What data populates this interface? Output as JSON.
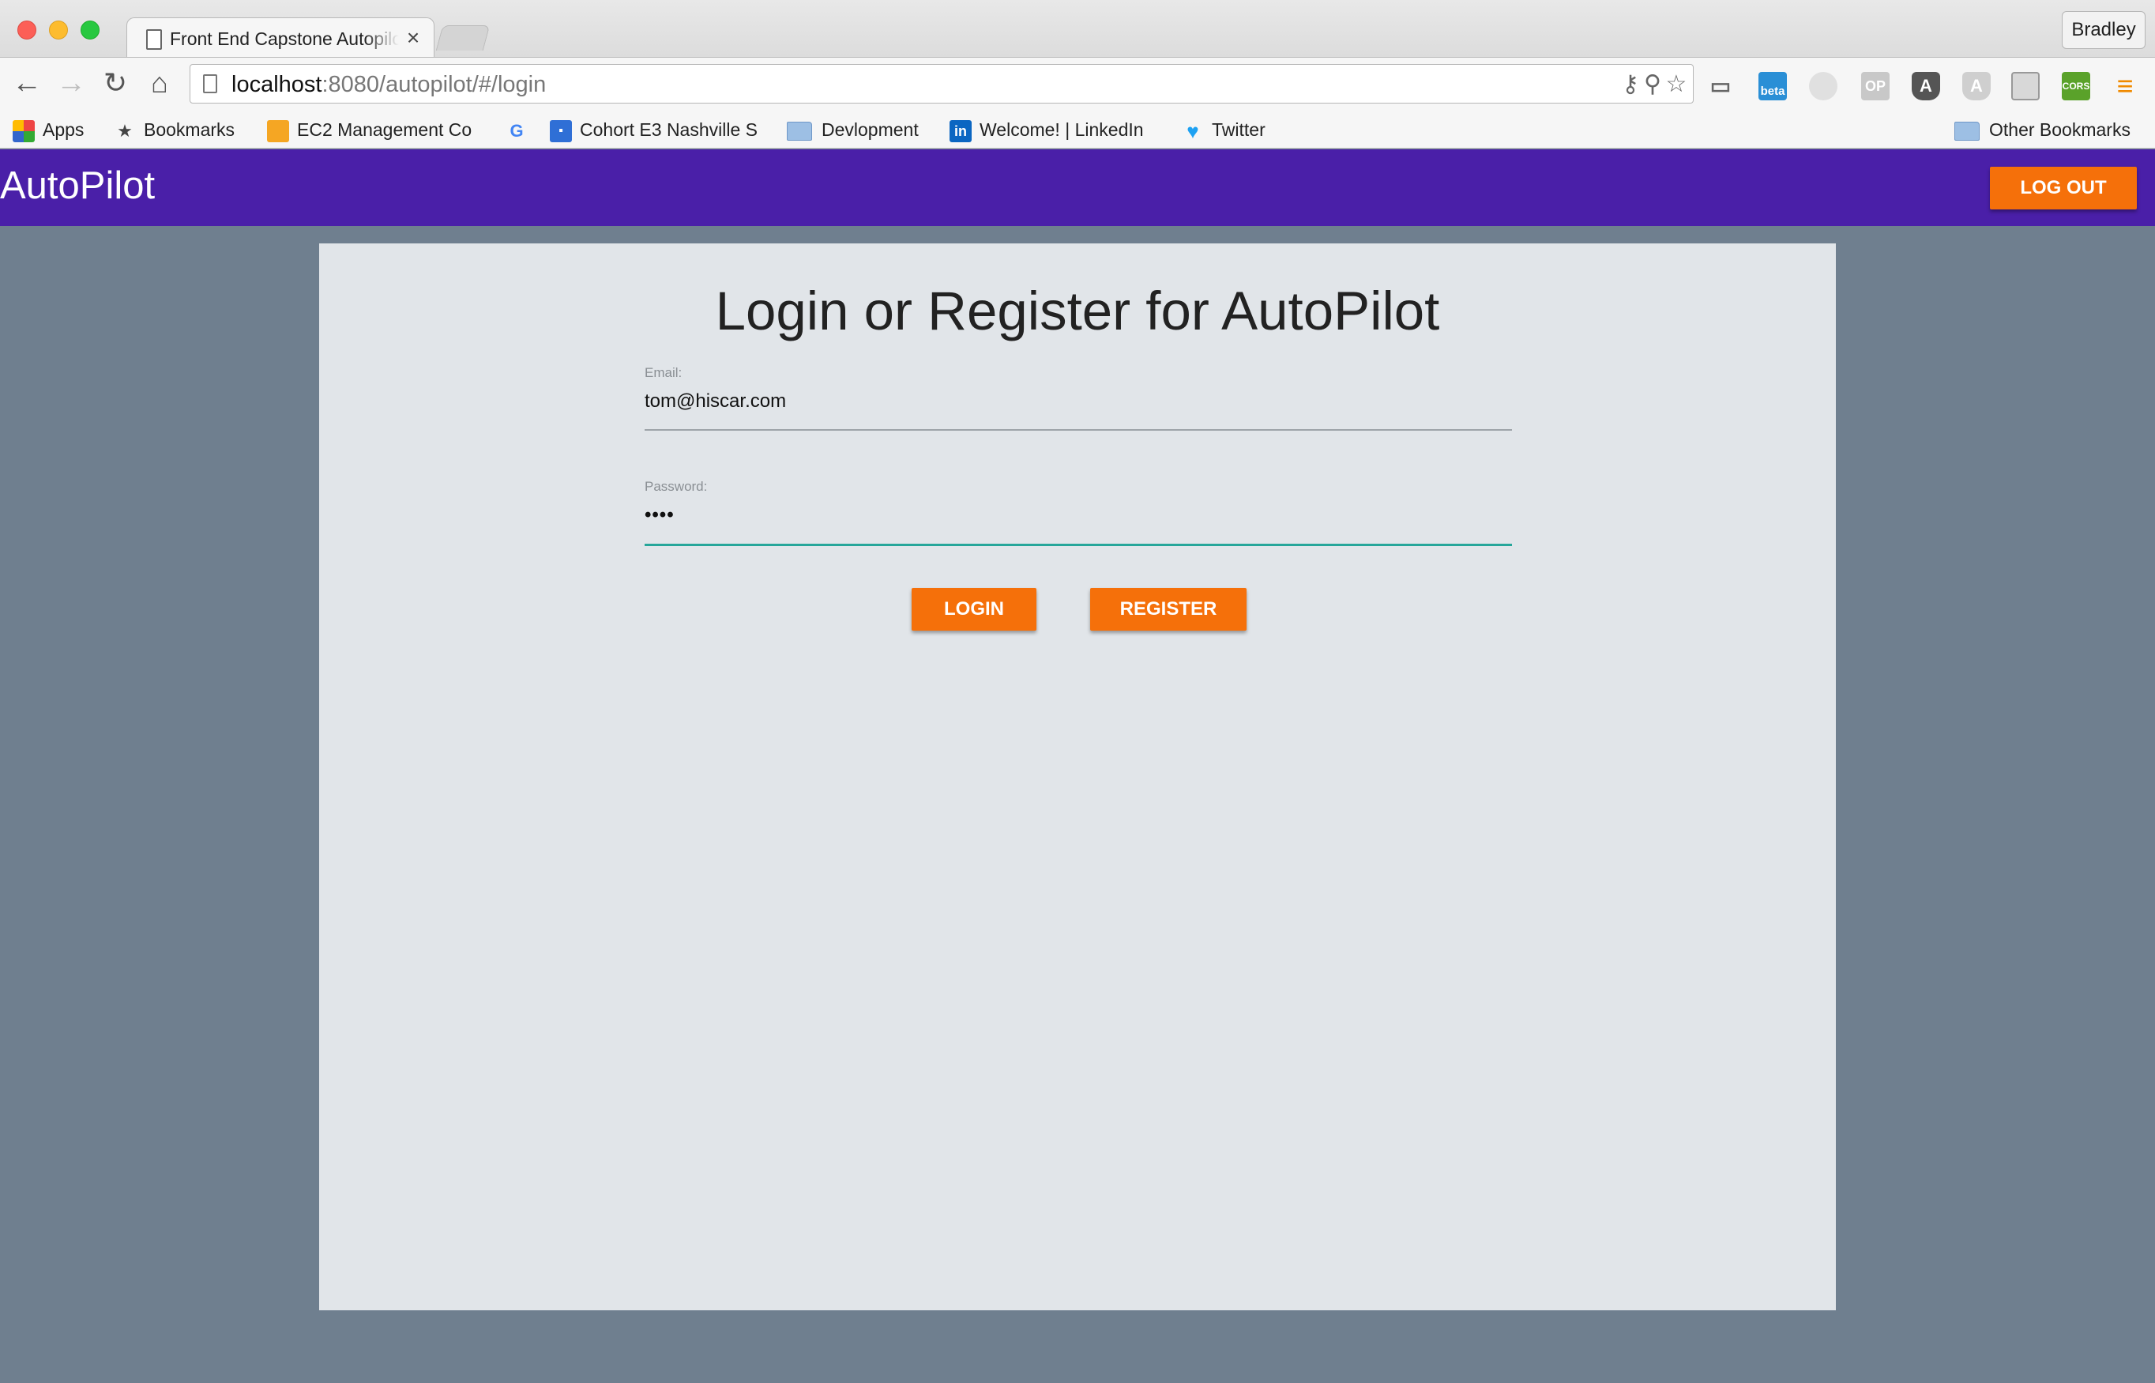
{
  "browser": {
    "tab_title": "Front End Capstone Autopilot",
    "tab_close": "×",
    "profile_name": "Bradley",
    "url_host": "localhost",
    "url_rest": ":8080/autopilot/#/login",
    "icons": {
      "back": "back-arrow-icon",
      "forward": "forward-arrow-icon",
      "reload": "reload-icon",
      "home": "home-icon",
      "key": "key-icon",
      "zoom": "zoom-icon",
      "star": "bookmark-star-icon",
      "cast": "cast-icon",
      "menu": "menu-icon"
    },
    "bookmarks": [
      {
        "label": "Apps",
        "icon": "apps-grid-icon"
      },
      {
        "label": "Bookmarks",
        "icon": "star-icon"
      },
      {
        "label": "EC2 Management Co",
        "icon": "aws-box-icon"
      },
      {
        "label": "",
        "icon": "google-icon"
      },
      {
        "label": "Cohort E3 Nashville S",
        "icon": "classroom-icon"
      },
      {
        "label": "Devlopment",
        "icon": "folder-icon"
      },
      {
        "label": "Welcome! | LinkedIn",
        "icon": "linkedin-icon"
      },
      {
        "label": "Twitter",
        "icon": "twitter-icon"
      },
      {
        "label": "Other Bookmarks",
        "icon": "folder-icon"
      }
    ],
    "extensions": [
      {
        "name": "beta-extension-icon",
        "text": "beta"
      },
      {
        "name": "circle-extension-icon",
        "text": ""
      },
      {
        "name": "op-extension-icon",
        "text": "OP"
      },
      {
        "name": "angular-dark-extension-icon",
        "text": "A"
      },
      {
        "name": "angular-light-extension-icon",
        "text": "A"
      },
      {
        "name": "panel-extension-icon",
        "text": ""
      },
      {
        "name": "cors-extension-icon",
        "text": "CORS"
      }
    ]
  },
  "app": {
    "title": "AutoPilot",
    "logout_label": "LOG OUT",
    "heading": "Login or Register for AutoPilot",
    "email": {
      "label": "Email:",
      "value": "tom@hiscar.com"
    },
    "password": {
      "label": "Password:",
      "value": "••••"
    },
    "login_label": "LOGIN",
    "register_label": "REGISTER",
    "colors": {
      "header": "#4a1fa8",
      "accent_button": "#f5700a",
      "active_underline": "#26a69a",
      "background": "#6f7f8f",
      "card": "#e1e5e9"
    }
  }
}
